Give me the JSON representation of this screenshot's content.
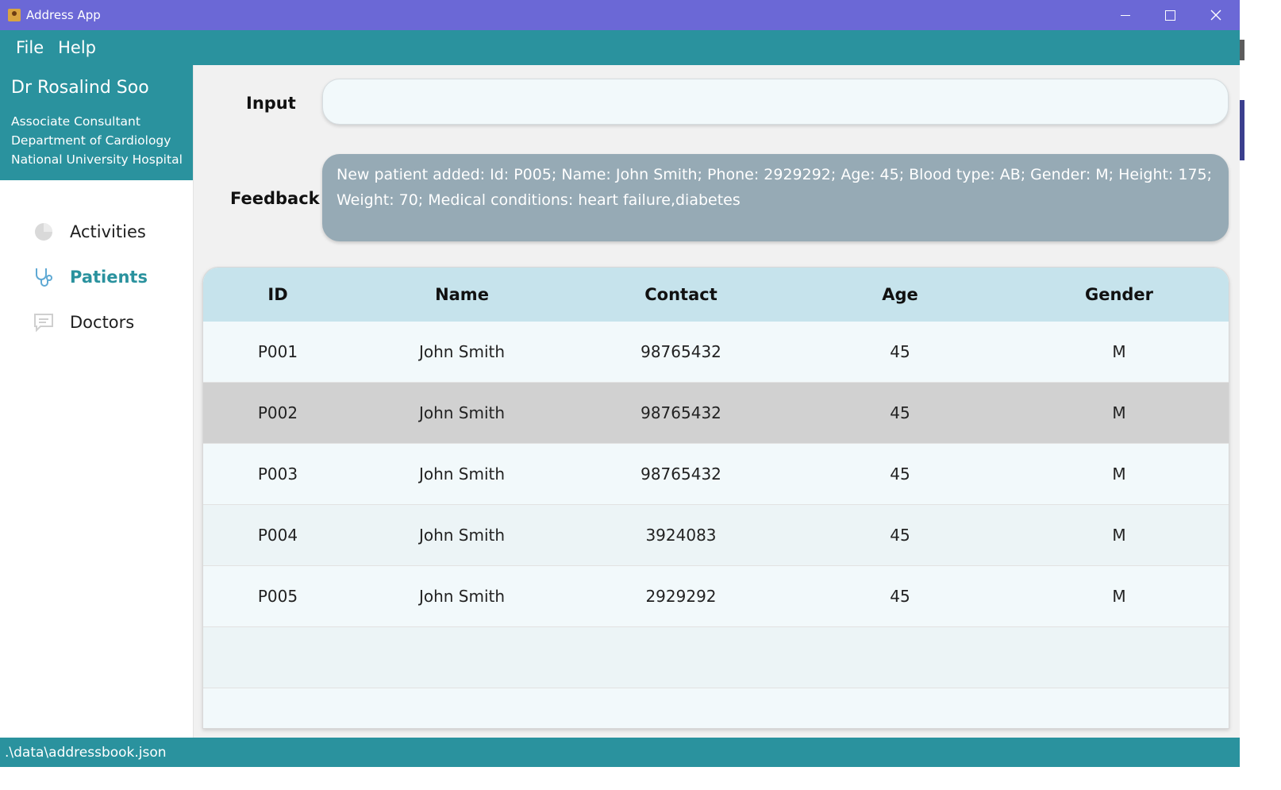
{
  "window": {
    "title": "Address App"
  },
  "menu": {
    "items": [
      "File",
      "Help"
    ]
  },
  "profile": {
    "name": "Dr Rosalind Soo",
    "lines": [
      "Associate Consultant",
      "Department of Cardiology",
      "National University Hospital"
    ]
  },
  "nav": {
    "items": [
      {
        "label": "Activities",
        "icon": "pie-chart-icon"
      },
      {
        "label": "Patients",
        "icon": "stethoscope-icon",
        "active": true
      },
      {
        "label": "Doctors",
        "icon": "chat-icon"
      }
    ]
  },
  "input": {
    "label": "Input",
    "value": ""
  },
  "feedback": {
    "label": "Feedback",
    "text": "New patient added: Id: P005; Name: John Smith; Phone: 2929292; Age: 45; Blood type: AB; Gender: M; Height: 175; Weight: 70; Medical conditions: heart failure,diabetes"
  },
  "table": {
    "columns": [
      "ID",
      "Name",
      "Contact",
      "Age",
      "Gender"
    ],
    "rows": [
      [
        "P001",
        "John Smith",
        "98765432",
        "45",
        "M"
      ],
      [
        "P002",
        "John Smith",
        "98765432",
        "45",
        "M"
      ],
      [
        "P003",
        "John Smith",
        "98765432",
        "45",
        "M"
      ],
      [
        "P004",
        "John Smith",
        "3924083",
        "45",
        "M"
      ],
      [
        "P005",
        "John Smith",
        "2929292",
        "45",
        "M"
      ]
    ],
    "selected_row": 1
  },
  "status": {
    "path": ".\\data\\addressbook.json"
  },
  "colors": {
    "titlebar": "#6b68d6",
    "accent": "#2a929e",
    "table_header": "#c6e3ec",
    "feedback_bg": "#96aab5",
    "selected_row": "#d1d1d1"
  }
}
